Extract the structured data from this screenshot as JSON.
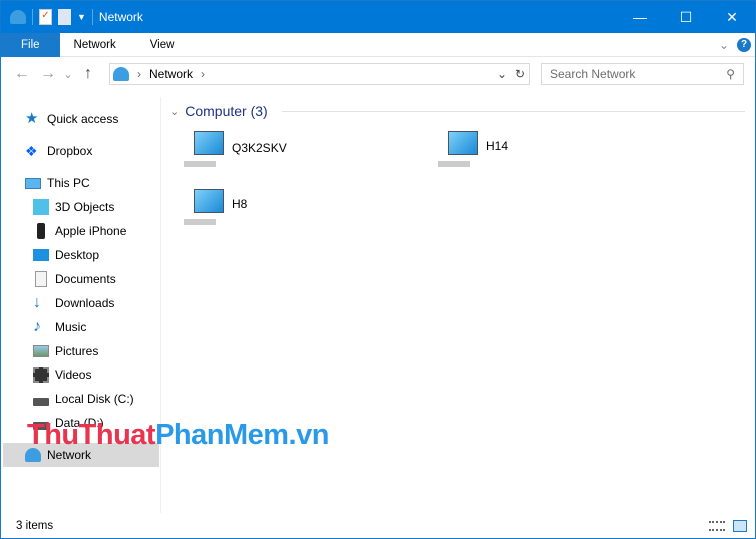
{
  "window": {
    "title": "Network",
    "minimize": "—",
    "maximize": "☐",
    "close": "✕"
  },
  "ribbon": {
    "tabs": [
      {
        "label": "File"
      },
      {
        "label": "Network"
      },
      {
        "label": "View"
      }
    ],
    "expand": "⌄",
    "help": "?"
  },
  "address": {
    "back": "←",
    "forward": "→",
    "recent": "⌄",
    "up": "↑",
    "crumb": "Network",
    "refresh": "↻",
    "dropdown": "⌄"
  },
  "search": {
    "placeholder": "Search Network"
  },
  "sidebar": {
    "items": [
      {
        "label": "Quick access",
        "icon": "star-icon"
      },
      {
        "label": "Dropbox",
        "icon": "dropbox-icon"
      },
      {
        "label": "This PC",
        "icon": "pc-icon"
      },
      {
        "label": "3D Objects",
        "icon": "cube-icon"
      },
      {
        "label": "Apple iPhone",
        "icon": "phone-icon"
      },
      {
        "label": "Desktop",
        "icon": "desktop-icon"
      },
      {
        "label": "Documents",
        "icon": "document-icon"
      },
      {
        "label": "Downloads",
        "icon": "download-icon"
      },
      {
        "label": "Music",
        "icon": "music-icon"
      },
      {
        "label": "Pictures",
        "icon": "pictures-icon"
      },
      {
        "label": "Videos",
        "icon": "video-icon"
      },
      {
        "label": "Local Disk (C:)",
        "icon": "disk-icon"
      },
      {
        "label": "Data (D:)",
        "icon": "disk-icon"
      },
      {
        "label": "Network",
        "icon": "network-icon"
      }
    ]
  },
  "main": {
    "group": "Computer (3)",
    "computers": [
      {
        "name": "Q3K2SKV"
      },
      {
        "name": "H14"
      },
      {
        "name": "H8"
      }
    ]
  },
  "status": {
    "count": "3 items"
  },
  "watermark": {
    "part1": "ThuThuat",
    "part2": "PhanMem.vn"
  },
  "colors": {
    "accent": "#0078d7",
    "file_tab": "#1979ca",
    "group": "#1e3287"
  }
}
